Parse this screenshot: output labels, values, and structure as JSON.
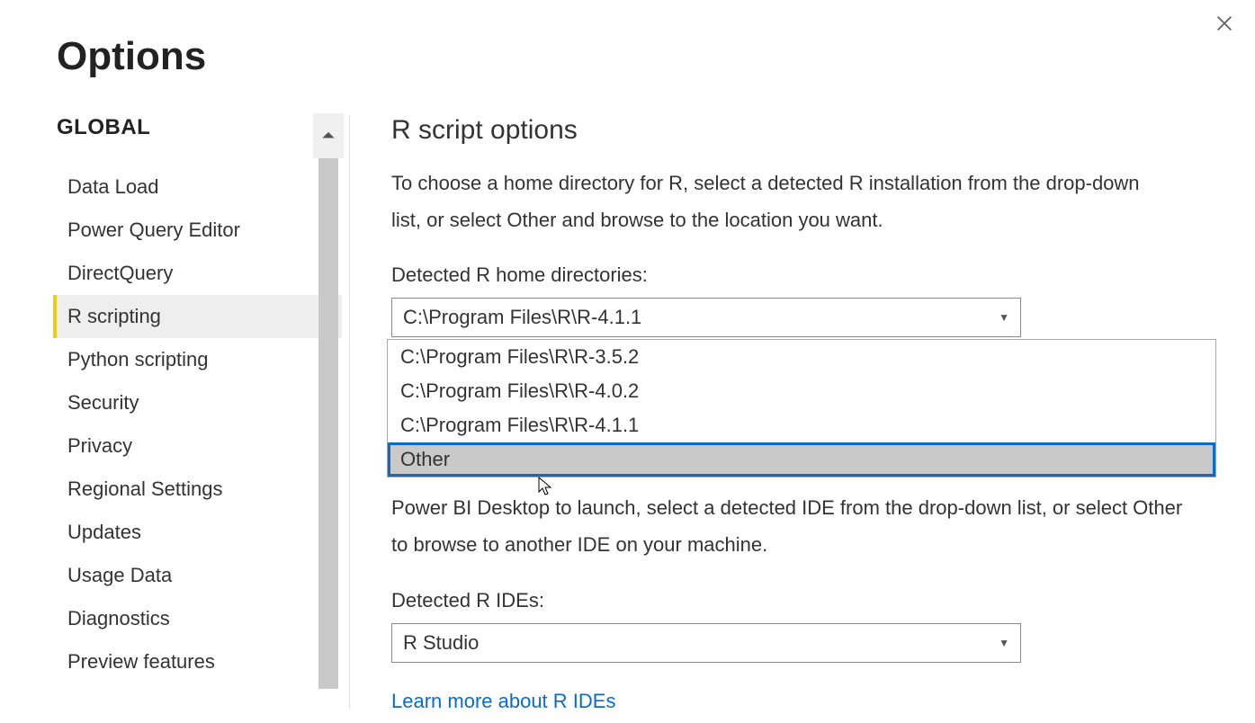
{
  "title": "Options",
  "sidebar": {
    "header": "GLOBAL",
    "items": [
      {
        "label": "Data Load"
      },
      {
        "label": "Power Query Editor"
      },
      {
        "label": "DirectQuery"
      },
      {
        "label": "R scripting"
      },
      {
        "label": "Python scripting"
      },
      {
        "label": "Security"
      },
      {
        "label": "Privacy"
      },
      {
        "label": "Regional Settings"
      },
      {
        "label": "Updates"
      },
      {
        "label": "Usage Data"
      },
      {
        "label": "Diagnostics"
      },
      {
        "label": "Preview features"
      }
    ],
    "active_index": 3
  },
  "main": {
    "section_title": "R script options",
    "section_desc": "To choose a home directory for R, select a detected R installation from the drop-down list, or select Other and browse to the location you want.",
    "home_label": "Detected R home directories:",
    "home_selected": "C:\\Program Files\\R\\R-4.1.1",
    "home_options": [
      "C:\\Program Files\\R\\R-3.5.2",
      "C:\\Program Files\\R\\R-4.0.2",
      "C:\\Program Files\\R\\R-4.1.1",
      "Other"
    ],
    "home_highlight_index": 3,
    "behind_text": "Power BI Desktop to launch, select a detected IDE from the drop-down list, or select Other to browse to another IDE on your machine.",
    "ide_label": "Detected R IDEs:",
    "ide_selected": "R Studio",
    "ide_link": "Learn more about R IDEs"
  }
}
